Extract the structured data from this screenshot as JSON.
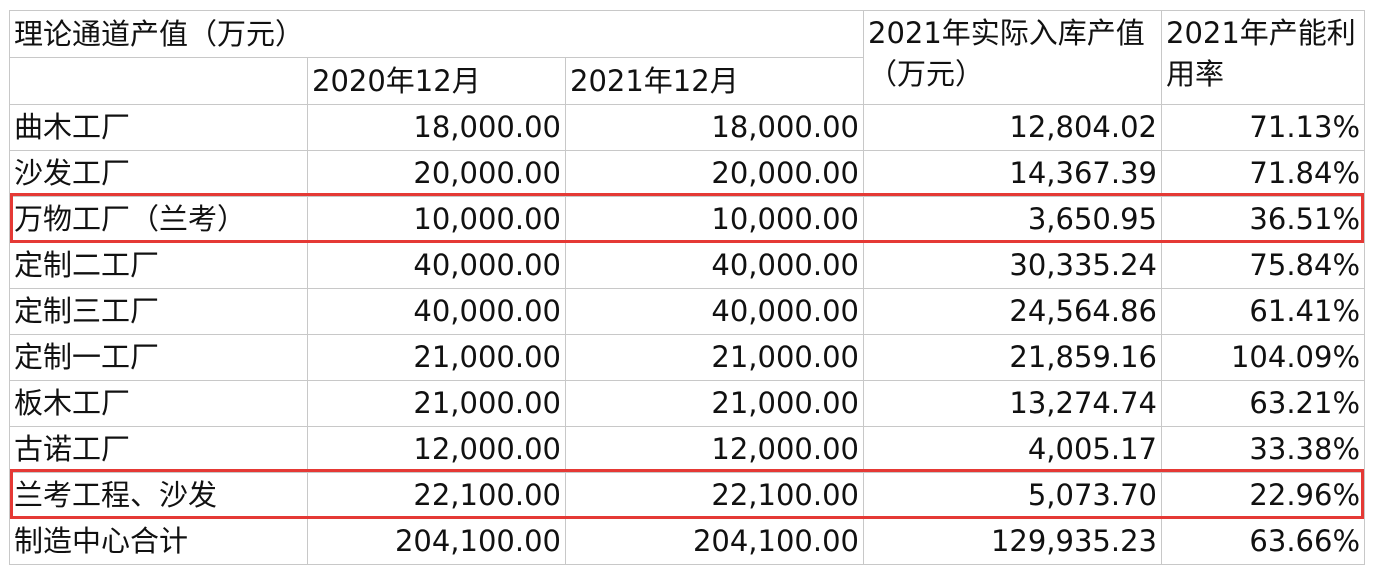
{
  "header": {
    "group_title": "理论通道产值（万元）",
    "col_2020": "2020年12月",
    "col_2021": "2021年12月",
    "col_actual": "2021年实际入库产值（万元）",
    "col_util": "2021年产能利用率"
  },
  "rows": [
    {
      "name": "曲木工厂",
      "v2020": "18,000.00",
      "v2021": "18,000.00",
      "actual": "12,804.02",
      "util": "71.13%"
    },
    {
      "name": "沙发工厂",
      "v2020": "20,000.00",
      "v2021": "20,000.00",
      "actual": "14,367.39",
      "util": "71.84%"
    },
    {
      "name": "万物工厂（兰考）",
      "v2020": "10,000.00",
      "v2021": "10,000.00",
      "actual": "3,650.95",
      "util": "36.51%"
    },
    {
      "name": "定制二工厂",
      "v2020": "40,000.00",
      "v2021": "40,000.00",
      "actual": "30,335.24",
      "util": "75.84%"
    },
    {
      "name": "定制三工厂",
      "v2020": "40,000.00",
      "v2021": "40,000.00",
      "actual": "24,564.86",
      "util": "61.41%"
    },
    {
      "name": "定制一工厂",
      "v2020": "21,000.00",
      "v2021": "21,000.00",
      "actual": "21,859.16",
      "util": "104.09%"
    },
    {
      "name": "板木工厂",
      "v2020": "21,000.00",
      "v2021": "21,000.00",
      "actual": "13,274.74",
      "util": "63.21%"
    },
    {
      "name": "古诺工厂",
      "v2020": "12,000.00",
      "v2021": "12,000.00",
      "actual": "4,005.17",
      "util": "33.38%"
    },
    {
      "name": "兰考工程、沙发",
      "v2020": "22,100.00",
      "v2021": "22,100.00",
      "actual": "5,073.70",
      "util": "22.96%"
    },
    {
      "name": "制造中心合计",
      "v2020": "204,100.00",
      "v2021": "204,100.00",
      "actual": "129,935.23",
      "util": "63.66%"
    }
  ],
  "highlight_color": "#e53935"
}
